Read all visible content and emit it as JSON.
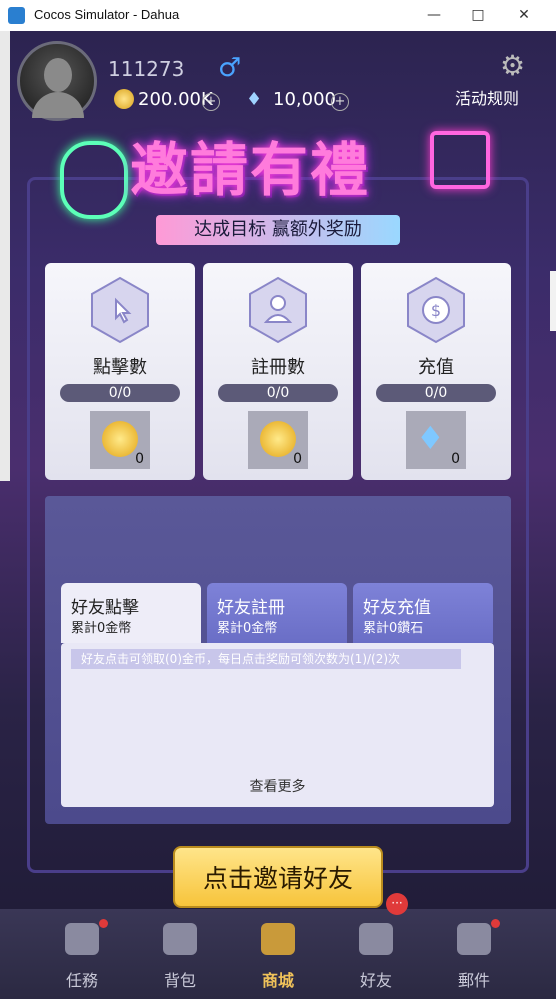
{
  "window": {
    "title": "Cocos Simulator - Dahua",
    "minimize": "—",
    "maximize": "□",
    "close": "✕"
  },
  "profile": {
    "uid": "111273",
    "gender_icon": "male-icon",
    "coins": "200.00K",
    "diamonds": "10,000",
    "plus": "+"
  },
  "header": {
    "rules_label": "活动规则"
  },
  "banner": {
    "title": "邀請有禮",
    "subtitle": "达成目标 赢额外奖励"
  },
  "stats": [
    {
      "label": "點擊數",
      "progress": "0/0",
      "reward_count": "0",
      "icon": "click-icon",
      "reward": "coin"
    },
    {
      "label": "註冊數",
      "progress": "0/0",
      "reward_count": "0",
      "icon": "user-icon",
      "reward": "coin"
    },
    {
      "label": "充值",
      "progress": "0/0",
      "reward_count": "0",
      "icon": "dollar-icon",
      "reward": "diamond"
    }
  ],
  "tabs": [
    {
      "title": "好友點擊",
      "sub": "累計0金幣"
    },
    {
      "title": "好友註冊",
      "sub": "累計0金幣"
    },
    {
      "title": "好友充值",
      "sub": "累計0鑽石"
    }
  ],
  "content": {
    "info": "好友点击可领取(0)金币，每日点击奖励可领次数为(1)/(2)次",
    "more": "查看更多"
  },
  "invite_button": "点击邀请好友",
  "nav": [
    {
      "label": "任務"
    },
    {
      "label": "背包"
    },
    {
      "label": "商城"
    },
    {
      "label": "好友",
      "badge": "···"
    },
    {
      "label": "郵件"
    }
  ],
  "colors": {
    "accent": "#f7c43b",
    "panel": "#5a5898",
    "banner_glow": "#ff3cd0"
  }
}
